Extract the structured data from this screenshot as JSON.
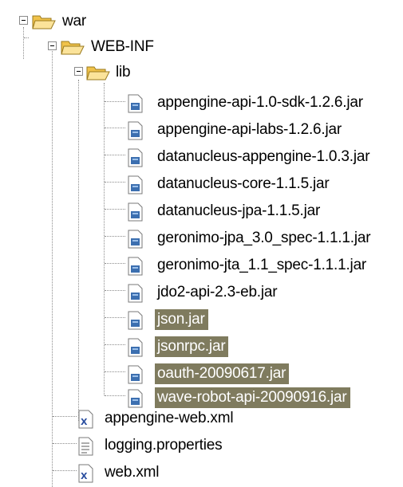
{
  "tree": {
    "root": {
      "label": "war",
      "expanded": true,
      "icon": "open-folder-icon",
      "children": [
        {
          "label": "WEB-INF",
          "expanded": true,
          "icon": "open-folder-icon",
          "children": [
            {
              "label": "lib",
              "expanded": true,
              "icon": "open-folder-icon",
              "children": [
                {
                  "label": "appengine-api-1.0-sdk-1.2.6.jar",
                  "icon": "jar-file-icon",
                  "selected": false
                },
                {
                  "label": "appengine-api-labs-1.2.6.jar",
                  "icon": "jar-file-icon",
                  "selected": false
                },
                {
                  "label": "datanucleus-appengine-1.0.3.jar",
                  "icon": "jar-file-icon",
                  "selected": false
                },
                {
                  "label": "datanucleus-core-1.1.5.jar",
                  "icon": "jar-file-icon",
                  "selected": false
                },
                {
                  "label": "datanucleus-jpa-1.1.5.jar",
                  "icon": "jar-file-icon",
                  "selected": false
                },
                {
                  "label": "geronimo-jpa_3.0_spec-1.1.1.jar",
                  "icon": "jar-file-icon",
                  "selected": false
                },
                {
                  "label": "geronimo-jta_1.1_spec-1.1.1.jar",
                  "icon": "jar-file-icon",
                  "selected": false
                },
                {
                  "label": "jdo2-api-2.3-eb.jar",
                  "icon": "jar-file-icon",
                  "selected": false
                },
                {
                  "label": "json.jar",
                  "icon": "jar-file-icon",
                  "selected": true
                },
                {
                  "label": "jsonrpc.jar",
                  "icon": "jar-file-icon",
                  "selected": true
                },
                {
                  "label": "oauth-20090617.jar",
                  "icon": "jar-file-icon",
                  "selected": true
                },
                {
                  "label": "wave-robot-api-20090916.jar",
                  "icon": "jar-file-icon",
                  "selected": true
                }
              ]
            },
            {
              "label": "appengine-web.xml",
              "icon": "xml-file-icon",
              "selected": false
            },
            {
              "label": "logging.properties",
              "icon": "properties-file-icon",
              "selected": false
            },
            {
              "label": "web.xml",
              "icon": "xml-file-icon",
              "selected": false
            }
          ]
        }
      ]
    }
  },
  "colors": {
    "selection_background": "#7f7b5e",
    "selection_text": "#ffffff",
    "folder_fill": "#f8d878",
    "guide_lines": "#8c8c8c"
  }
}
